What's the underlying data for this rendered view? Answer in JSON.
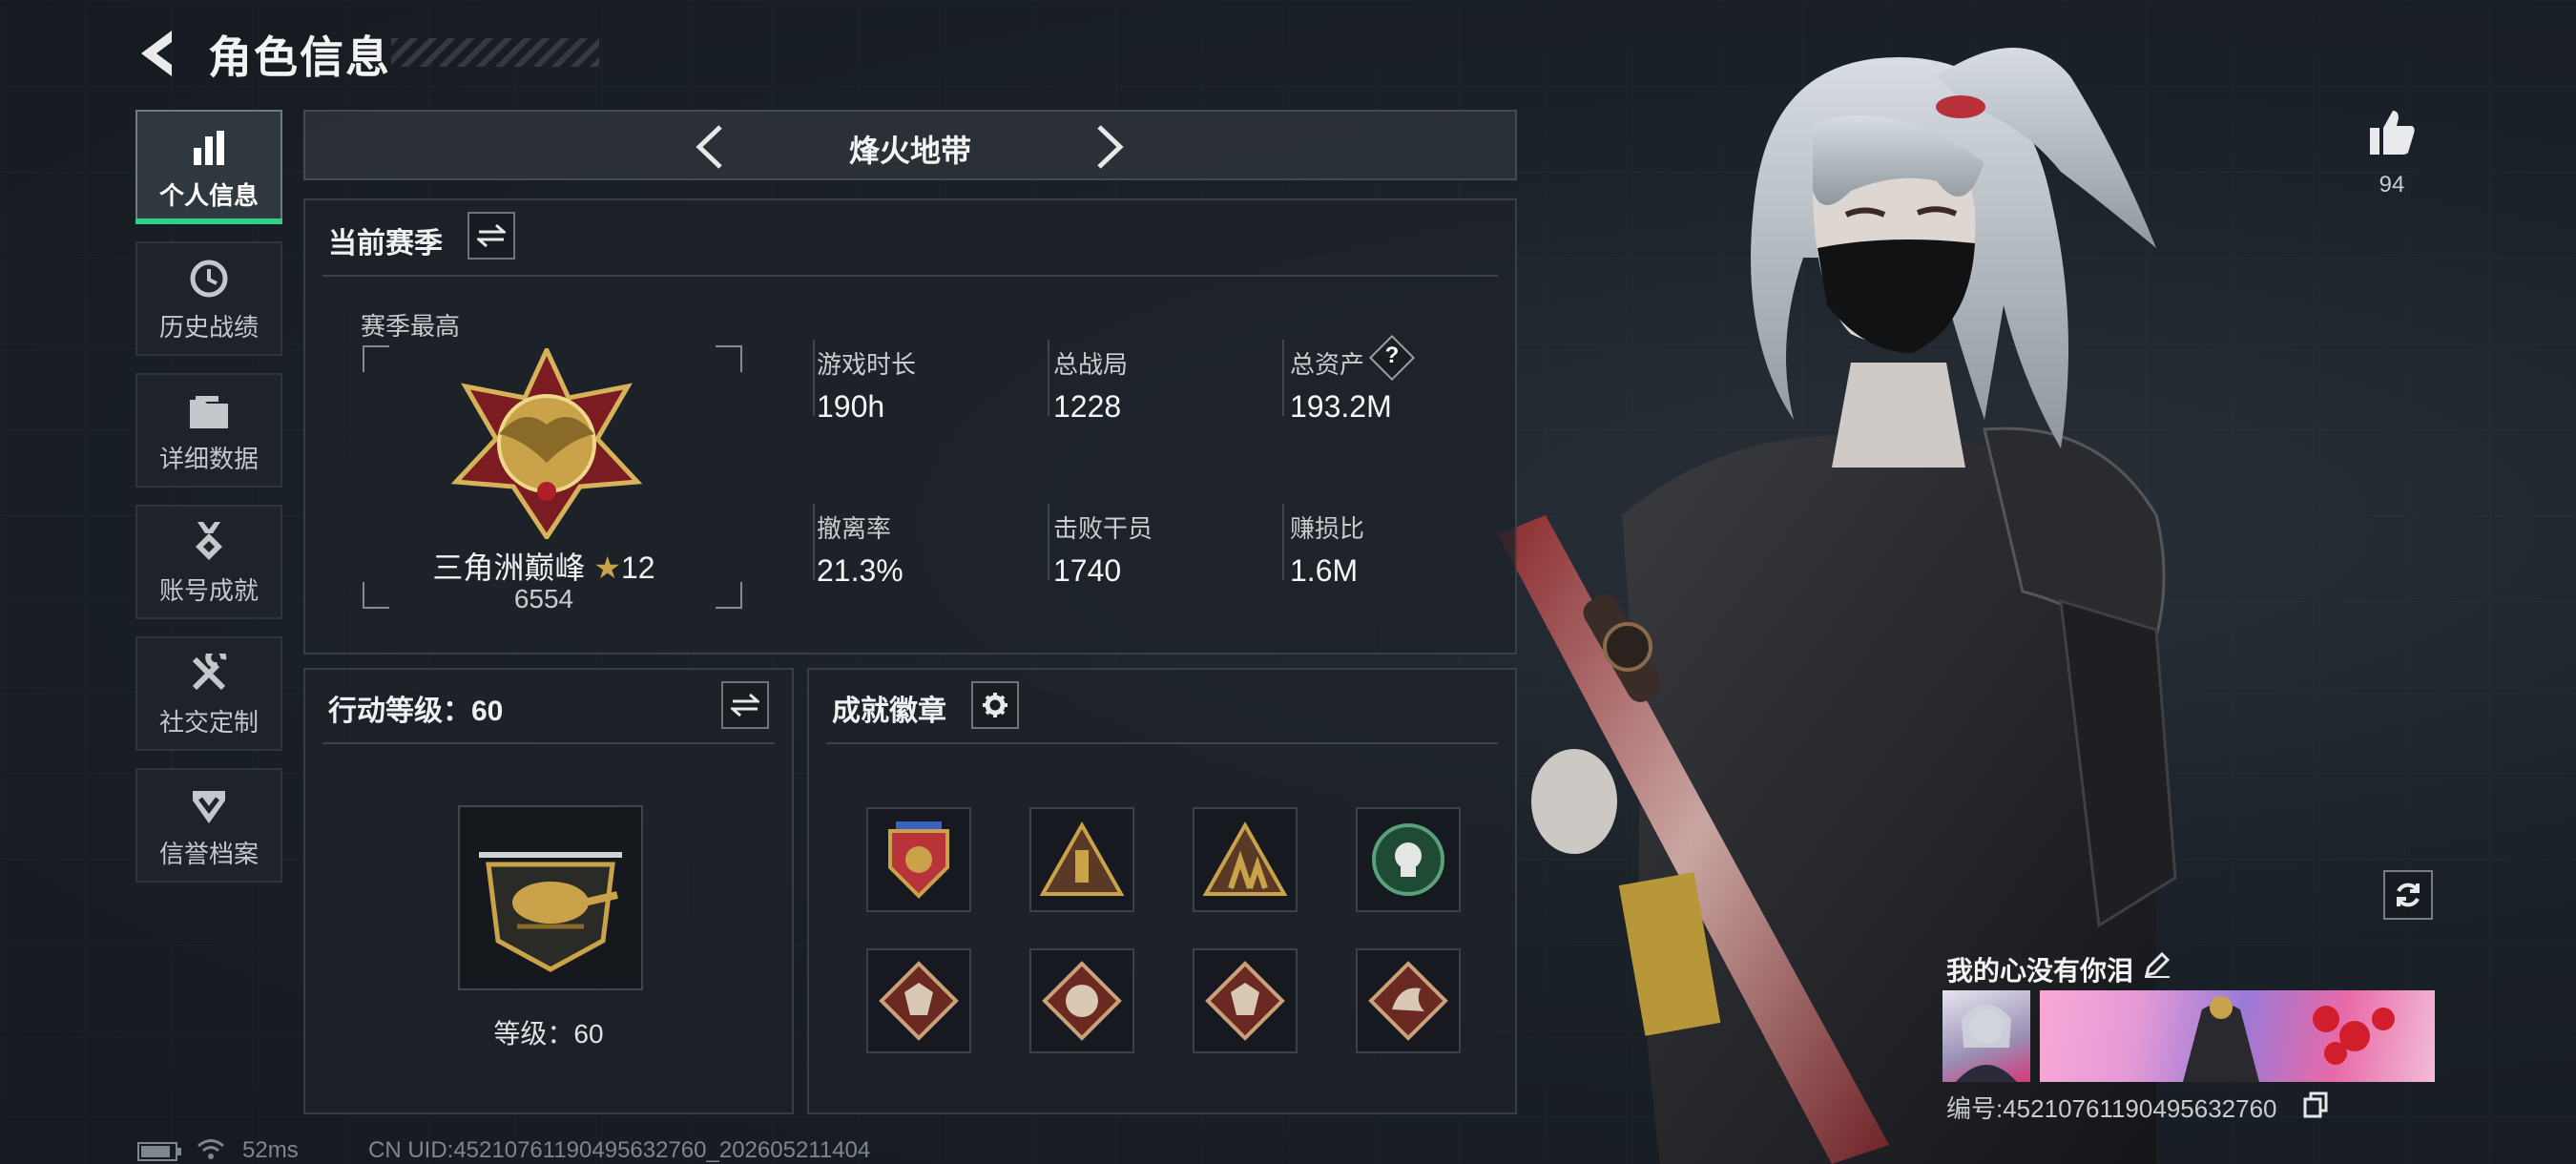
{
  "header": {
    "title": "角色信息"
  },
  "sidebar": {
    "items": [
      {
        "label": "个人信息",
        "icon": "bar-chart-icon",
        "active": true
      },
      {
        "label": "历史战绩",
        "icon": "history-clock-icon"
      },
      {
        "label": "详细数据",
        "icon": "folder-icon"
      },
      {
        "label": "账号成就",
        "icon": "achievement-medal-icon"
      },
      {
        "label": "社交定制",
        "icon": "wrench-screwdriver-icon"
      },
      {
        "label": "信誉档案",
        "icon": "shield-check-icon"
      }
    ]
  },
  "mode": {
    "name": "烽火地带"
  },
  "season": {
    "title": "当前赛季",
    "best_label": "赛季最高",
    "rank_name": "三角洲巅峰",
    "rank_stars": "12",
    "rank_score": "6554",
    "stats": [
      {
        "label": "游戏时长",
        "value": "190h"
      },
      {
        "label": "总战局",
        "value": "1228"
      },
      {
        "label": "总资产",
        "value": "193.2M",
        "help": "?"
      },
      {
        "label": "撤离率",
        "value": "21.3%"
      },
      {
        "label": "击败干员",
        "value": "1740"
      },
      {
        "label": "赚损比",
        "value": "1.6M"
      }
    ]
  },
  "action_level": {
    "title": "行动等级：60",
    "level_text": "等级：60"
  },
  "achievements": {
    "title": "成就徽章",
    "badges": [
      "eagle-shield-badge",
      "ammo-triangle-badge",
      "soldiers-triangle-badge",
      "skull-circle-badge",
      "wolf-diamond-badge",
      "tiger-diamond-badge",
      "wolf-diamond-badge-2",
      "dragon-diamond-badge"
    ]
  },
  "player": {
    "likes": "94",
    "signature": "我的心没有你泪",
    "uid_text": "编号:4521076119049563276​0"
  },
  "status_bar": {
    "ping": "52ms",
    "uid": "CN UID:452107611904956327​60_202605211404"
  },
  "colors": {
    "accent_green": "#2fd08a",
    "gold": "#c9a24a",
    "bg": "#1b2128"
  }
}
